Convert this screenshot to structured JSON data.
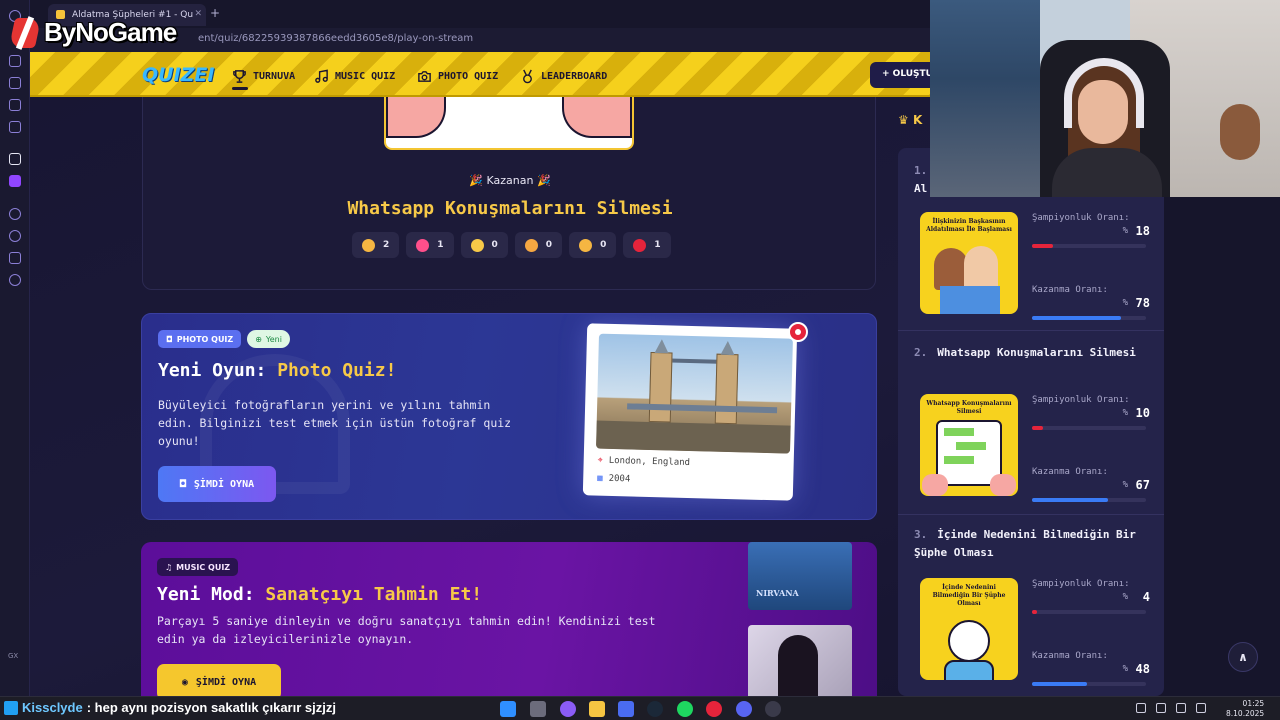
{
  "browser": {
    "tab_title": "Aldatma Şüpheleri #1 - Qu",
    "url": "ent/quiz/68225939387866eedd3605e8/play-on-stream",
    "rail_text": "GX"
  },
  "overlay": {
    "logo_text": "ByNoGame"
  },
  "nav": {
    "logo": "QUIZEI",
    "items": [
      {
        "label": "TURNUVA",
        "icon": "trophy-icon"
      },
      {
        "label": "MUSIC QUIZ",
        "icon": "music-note-icon"
      },
      {
        "label": "PHOTO QUIZ",
        "icon": "camera-icon"
      },
      {
        "label": "LEADERBOARD",
        "icon": "medal-icon"
      }
    ],
    "create_label": "+ OLUŞTU"
  },
  "winner": {
    "kazanan_label": "🎉  Kazanan  🎉",
    "title": "Whatsapp Konuşmalarını Silmesi",
    "reactions": [
      {
        "emoji": "thumbs-up",
        "count": "2",
        "color": "#f5b642"
      },
      {
        "emoji": "heart",
        "count": "1",
        "color": "#ff4f8b"
      },
      {
        "emoji": "laughing",
        "count": "0",
        "color": "#f7c948"
      },
      {
        "emoji": "surprised",
        "count": "0",
        "color": "#f5a742"
      },
      {
        "emoji": "sad",
        "count": "0",
        "color": "#f5b642"
      },
      {
        "emoji": "angry",
        "count": "1",
        "color": "#e5243b"
      }
    ]
  },
  "photo_quiz": {
    "badge": "PHOTO QUIZ",
    "new_badge": "Yeni",
    "title_prefix": "Yeni Oyun: ",
    "title_highlight": "Photo Quiz!",
    "description": "Büyüleyici fotoğrafların yerini ve yılını tahmin edin. Bilginizi test etmek için üstün fotoğraf quiz oyunu!",
    "button": "ŞİMDİ OYNA",
    "location": "London, England",
    "year": "2004"
  },
  "music_quiz": {
    "badge": "MUSIC QUIZ",
    "title_prefix": "Yeni Mod: ",
    "title_highlight": "Sanatçıyı Tahmin Et!",
    "description": "Parçayı 5 saniye dinleyin ve doğru sanatçıyı tahmin edin! Kendinizi test edin ya da izleyicilerinizle oynayın.",
    "button": "ŞİMDİ OYNA",
    "album1_text": "NIRVANA"
  },
  "leaderboard": {
    "header_partial": "K",
    "items": [
      {
        "rank": "1.",
        "title": "Al",
        "thumb_caption": "İlişkinizin Başkasının Aldatılması İle Başlaması",
        "champ_label": "Şampiyonluk Oranı:",
        "champ_value": "18",
        "champ_fill": 0.18,
        "win_label": "Kazanma Oranı:",
        "win_value": "78",
        "win_fill": 0.78
      },
      {
        "rank": "2.",
        "title": "Whatsapp Konuşmalarını Silmesi",
        "thumb_caption": "Whatsapp Konuşmalarını Silmesi",
        "champ_label": "Şampiyonluk Oranı:",
        "champ_value": "10",
        "champ_fill": 0.1,
        "win_label": "Kazanma Oranı:",
        "win_value": "67",
        "win_fill": 0.67
      },
      {
        "rank": "3.",
        "title": "İçinde Nedenini Bilmediğin Bir Şüphe Olması",
        "thumb_caption": "İçinde Nedenini Bilmediğin Bir Şüphe Olması",
        "champ_label": "Şampiyonluk Oranı:",
        "champ_value": "4",
        "champ_fill": 0.04,
        "win_label": "Kazanma Oranı:",
        "win_value": "48",
        "win_fill": 0.48
      }
    ],
    "percent_sign": "%"
  },
  "taskbar": {
    "chat_user": "Kissclyde",
    "chat_message": ": hep aynı pozisyon sakatlık çıkarır sjzjzj",
    "time": "01:25",
    "date": "8.10.2025"
  },
  "colors": {
    "accent_yellow": "#f7c948",
    "champ_bar": "#e5243b",
    "win_bar": "#3a7bf5"
  }
}
